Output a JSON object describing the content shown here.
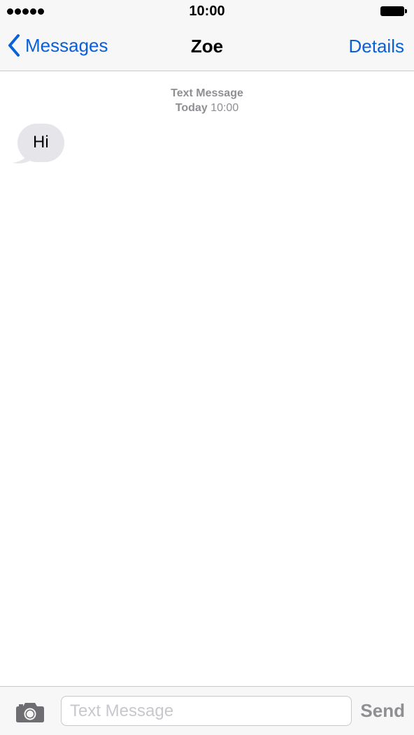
{
  "status_bar": {
    "time": "10:00",
    "signal_icon": "signal-dots-icon",
    "battery_icon": "battery-full-icon"
  },
  "nav": {
    "back_label": "Messages",
    "back_icon": "chevron-left-icon",
    "title": "Zoe",
    "details_label": "Details"
  },
  "conversation": {
    "service_label": "Text Message",
    "day_label": "Today",
    "time_label": "10:00",
    "messages": [
      {
        "direction": "incoming",
        "text": "Hi"
      }
    ]
  },
  "input_bar": {
    "camera_icon": "camera-icon",
    "placeholder": "Text Message",
    "send_label": "Send"
  },
  "colors": {
    "accent": "#0a60d8",
    "incoming_bubble": "#e5e5ea",
    "secondary_text": "#8e8e93",
    "bar_background": "#f7f7f7"
  }
}
